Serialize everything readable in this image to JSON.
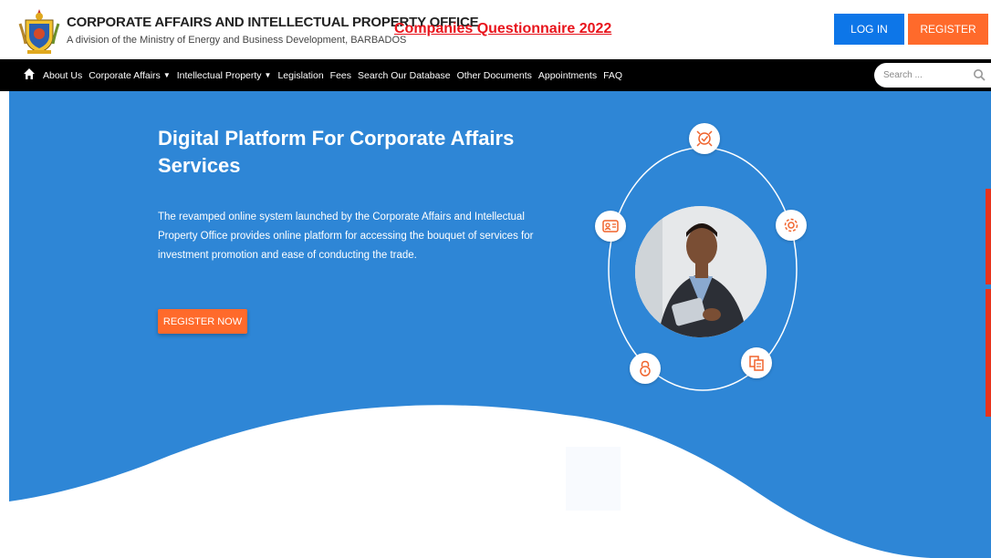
{
  "header": {
    "org_title": "CORPORATE AFFAIRS AND INTELLECTUAL PROPERTY OFFICE",
    "org_subtitle": "A division of the Ministry of Energy and Business Development, BARBADOS",
    "questionnaire_link": "Companies Questionnaire 2022",
    "login_label": "LOG IN",
    "register_label": "REGISTER"
  },
  "nav": {
    "items": [
      {
        "label": "About Us",
        "dropdown": false
      },
      {
        "label": "Corporate Affairs",
        "dropdown": true
      },
      {
        "label": "Intellectual Property",
        "dropdown": true
      },
      {
        "label": "Legislation",
        "dropdown": false
      },
      {
        "label": "Fees",
        "dropdown": false
      },
      {
        "label": "Search Our Database",
        "dropdown": false
      },
      {
        "label": "Other Documents",
        "dropdown": false
      },
      {
        "label": "Appointments",
        "dropdown": false
      },
      {
        "label": "FAQ",
        "dropdown": false
      }
    ],
    "search_placeholder": "Search ..."
  },
  "hero": {
    "title": "Digital Platform For Corporate Affairs Services",
    "text": "The revamped online system launched by the Corporate Affairs and Intellectual Property Office provides online platform for accessing the bouquet of services for investment promotion and ease of conducting the trade.",
    "cta_label": "REGISTER NOW"
  },
  "orbit_icons": [
    "target-check-icon",
    "id-card-icon",
    "gear-icon",
    "lock-icon",
    "document-copy-icon"
  ],
  "colors": {
    "hero_blue": "#2e86d6",
    "accent_orange": "#ff6a2b",
    "login_blue": "#0d76e8",
    "link_red": "#e8141c",
    "nav_black": "#000000"
  }
}
